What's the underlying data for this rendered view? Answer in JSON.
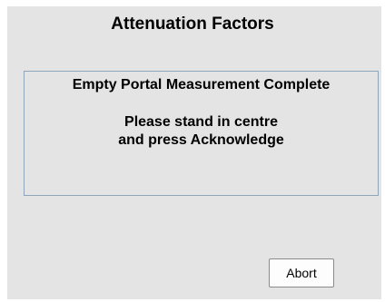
{
  "dialog": {
    "title": "Attenuation Factors",
    "message": {
      "heading": "Empty Portal Measurement Complete",
      "line1": "Please stand in centre",
      "line2": "and press Acknowledge"
    },
    "buttons": {
      "abort_label": "Abort"
    }
  },
  "colors": {
    "background": "#e4e4e4",
    "message_border": "#8fa5bb",
    "button_background": "#fdfdfd"
  }
}
